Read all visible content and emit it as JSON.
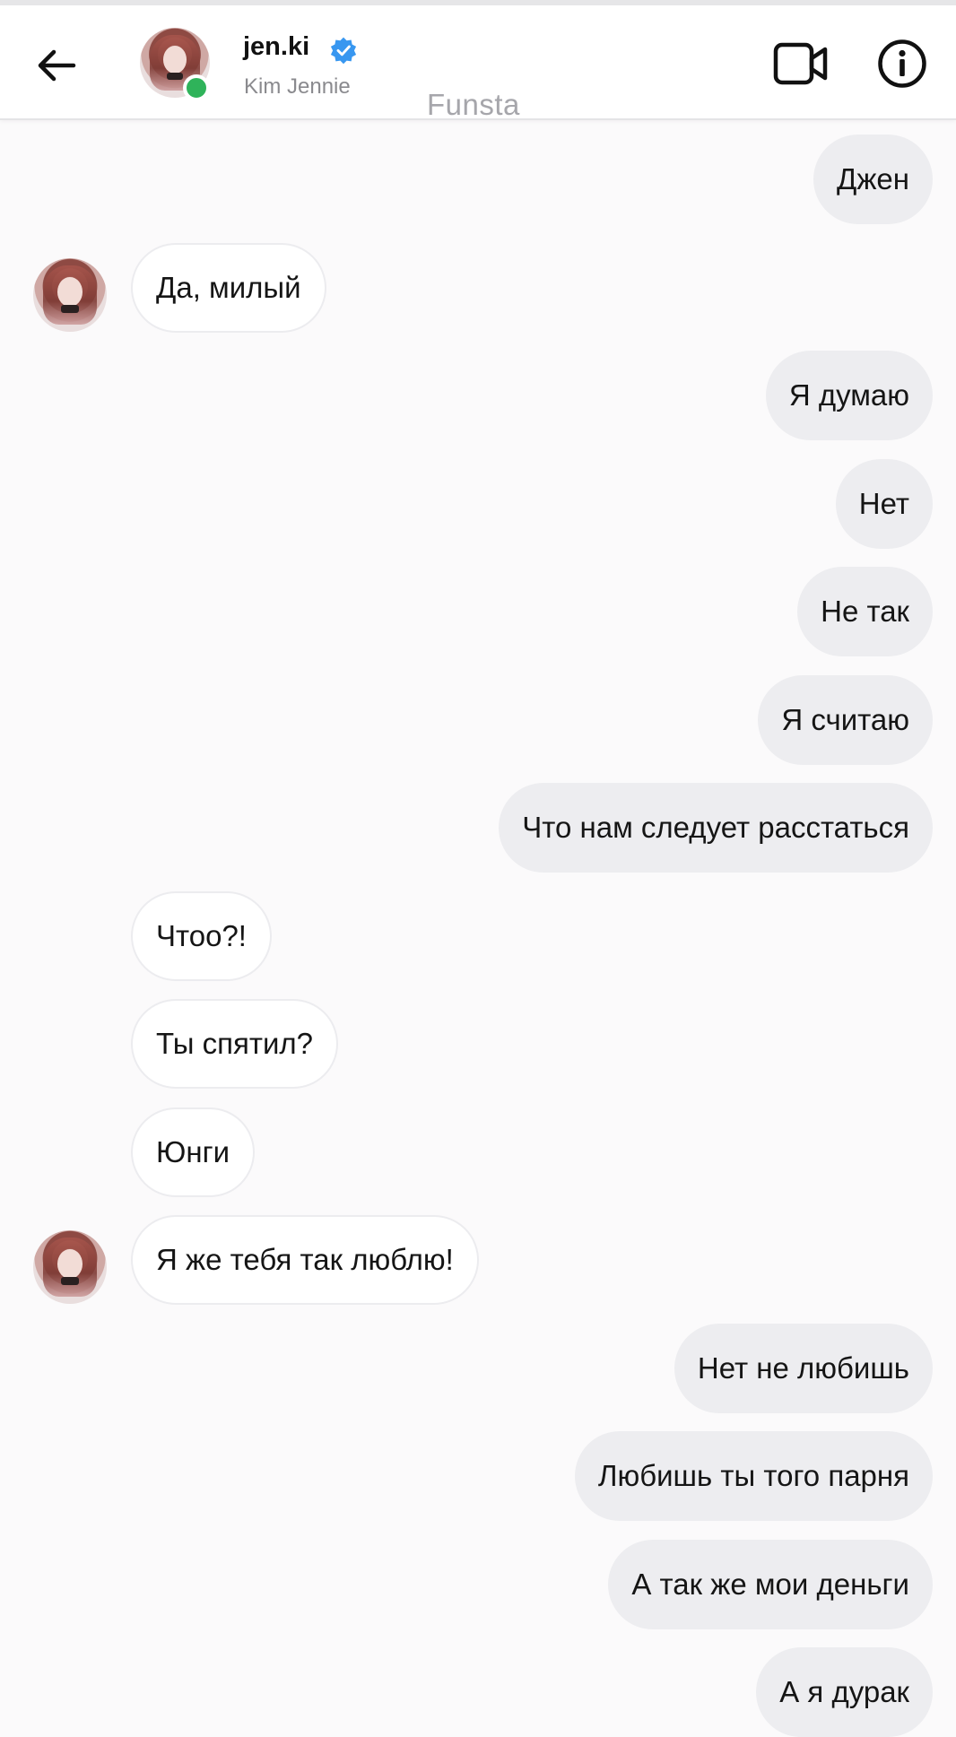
{
  "header": {
    "username": "jen.ki",
    "full_name": "Kim Jennie",
    "verified": true,
    "online": true,
    "watermark": "Funsta",
    "icons": {
      "back": "back-arrow-icon",
      "video": "video-call-icon",
      "info": "info-icon",
      "verified": "verified-badge-icon"
    }
  },
  "colors": {
    "online": "#2fb35a",
    "verified": "#3897f0",
    "sent_bubble": "#ededf0",
    "received_bubble": "#ffffff"
  },
  "messages": [
    {
      "text": "Джен",
      "dir": "sent"
    },
    {
      "text": "Да, милый",
      "dir": "recv",
      "avatar": true
    },
    {
      "text": "Я думаю",
      "dir": "sent"
    },
    {
      "text": "Нет",
      "dir": "sent"
    },
    {
      "text": "Не так",
      "dir": "sent"
    },
    {
      "text": "Я считаю",
      "dir": "sent"
    },
    {
      "text": "Что нам следует расстаться",
      "dir": "sent"
    },
    {
      "text": "Чтоо?!",
      "dir": "recv"
    },
    {
      "text": "Ты спятил?",
      "dir": "recv"
    },
    {
      "text": "Юнги",
      "dir": "recv"
    },
    {
      "text": "Я же тебя так люблю!",
      "dir": "recv",
      "avatar": true
    },
    {
      "text": "Нет не любишь",
      "dir": "sent"
    },
    {
      "text": "Любишь ты того парня",
      "dir": "sent"
    },
    {
      "text": "А так же мои деньги",
      "dir": "sent"
    },
    {
      "text": "А я дурак",
      "dir": "sent"
    }
  ]
}
